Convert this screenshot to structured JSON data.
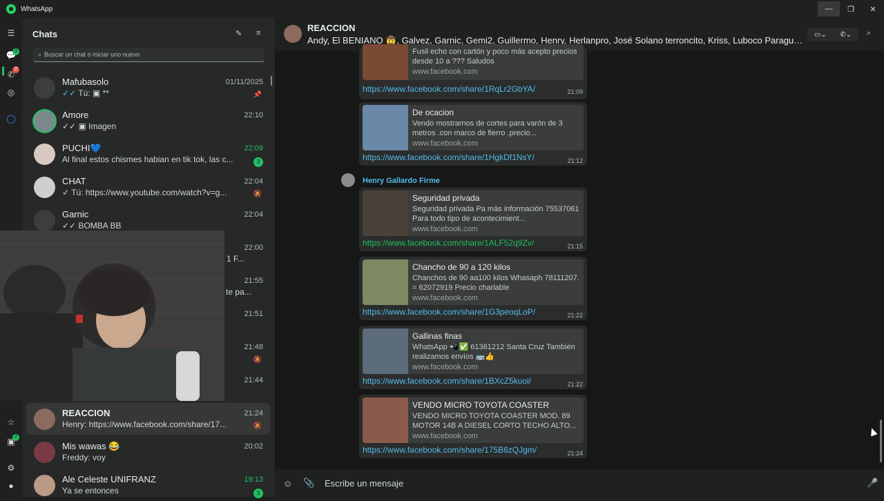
{
  "titlebar": {
    "app_name": "WhatsApp",
    "minimize": "—",
    "restore": "❐",
    "close": "✕"
  },
  "rail": {
    "chats_badge": "3",
    "status_badge": "2",
    "archive_badge": "2"
  },
  "sidebar": {
    "title": "Chats",
    "search_placeholder": "Buscar un chat o iniciar uno nuevo",
    "chats": [
      {
        "name": "Mafubasolo",
        "message": "Tú: ▣ **",
        "time": "01/11/2025",
        "ticks": "✓✓"
      },
      {
        "name": "Amore",
        "message": "▣ Imagen",
        "time": "22:10",
        "ticks": "✓✓"
      },
      {
        "name": "PUCHI💙",
        "message": "Al final estos chismes habian en tik tok, las c...",
        "time": "22:09",
        "badge": "3"
      },
      {
        "name": "CHAT",
        "message": "Tú: https://www.youtube.com/watch?v=g...",
        "time": "22:04",
        "ticks": "✓"
      },
      {
        "name": "Garnic",
        "message": "BOMBA BB",
        "time": "22:04",
        "ticks": "✓✓"
      },
      {
        "name": "",
        "message": "1 F...",
        "time": "22:00"
      },
      {
        "name": "",
        "message": "te pa...",
        "time": "21:55"
      },
      {
        "name": "",
        "message": "",
        "time": "21:51"
      },
      {
        "name": "",
        "message": "",
        "time": "21:48"
      },
      {
        "name": "",
        "message": "",
        "time": "21:44"
      },
      {
        "name": "REACCION",
        "message": "Henry: https://www.facebook.com/share/17...",
        "time": "21:24"
      },
      {
        "name": "Mis wawas 😂",
        "message": "Freddy: voy",
        "time": "20:02"
      },
      {
        "name": "Ale Celeste UNIFRANZ",
        "message": "Ya se entonces",
        "time": "19:13",
        "badge": "3"
      }
    ]
  },
  "conversation": {
    "title": "REACCION",
    "members": "Andy, El BENIANO 🤠, Galvez, Garnic, Gemi2, Guillermo, Henry, Herlanpro, José Solano terroncito, Kriss, Luboco Paragua...",
    "sender": "Henry Gallardo Firme",
    "messages": [
      {
        "title": "",
        "desc": "Fusil echo con cartón y poco más acepto precios desde 10 a ??? Saludos",
        "domain": "www.facebook.com",
        "link": "https://www.facebook.com/share/1RqLr2GbYA/",
        "time": "21:09"
      },
      {
        "title": "De ocacion",
        "desc": "Vendo mostrarnos de cortes para varón de 3 metros .con marco de fierro .precio...",
        "domain": "www.facebook.com",
        "link": "https://www.facebook.com/share/1HgkDf1NsY/",
        "time": "21:12"
      },
      {
        "title": "Seguridad privada",
        "desc": "Seguridad privada Pa más información 75537061 Para todo tipo de acontecimient...",
        "domain": "www.facebook.com",
        "link": "https://www.facebook.com/share/1ALF52q9Zv/",
        "time": "21:15"
      },
      {
        "title": "Chancho de 90 a 120 kilos",
        "desc": "Chanchos de 90 aa100 kilos Whasaph 78111207. = 62072919 Precio charlable",
        "domain": "www.facebook.com",
        "link": "https://www.facebook.com/share/1G3peoqLoP/",
        "time": "21:22"
      },
      {
        "title": "Gallinas finas",
        "desc": "WhatsApp 📲✅ 61361212 Santa Cruz También realizamos envíos 🚌👍",
        "domain": "www.facebook.com",
        "link": "https://www.facebook.com/share/1BXcZ5kuoi/",
        "time": "21:22"
      },
      {
        "title": "VENDO MICRO TOYOTA COASTER",
        "desc": "VENDO MICRO TOYOTA COASTER MOD. 89 MOTOR 14B A DIESEL CORTO TECHO ALTO...",
        "domain": "www.facebook.com",
        "link": "https://www.facebook.com/share/175B6zQJgm/",
        "time": "21:24"
      }
    ],
    "composer_placeholder": "Escribe un mensaje"
  },
  "colors": {
    "accent": "#21c063",
    "link": "#53bdeb",
    "bg": "#161717"
  }
}
